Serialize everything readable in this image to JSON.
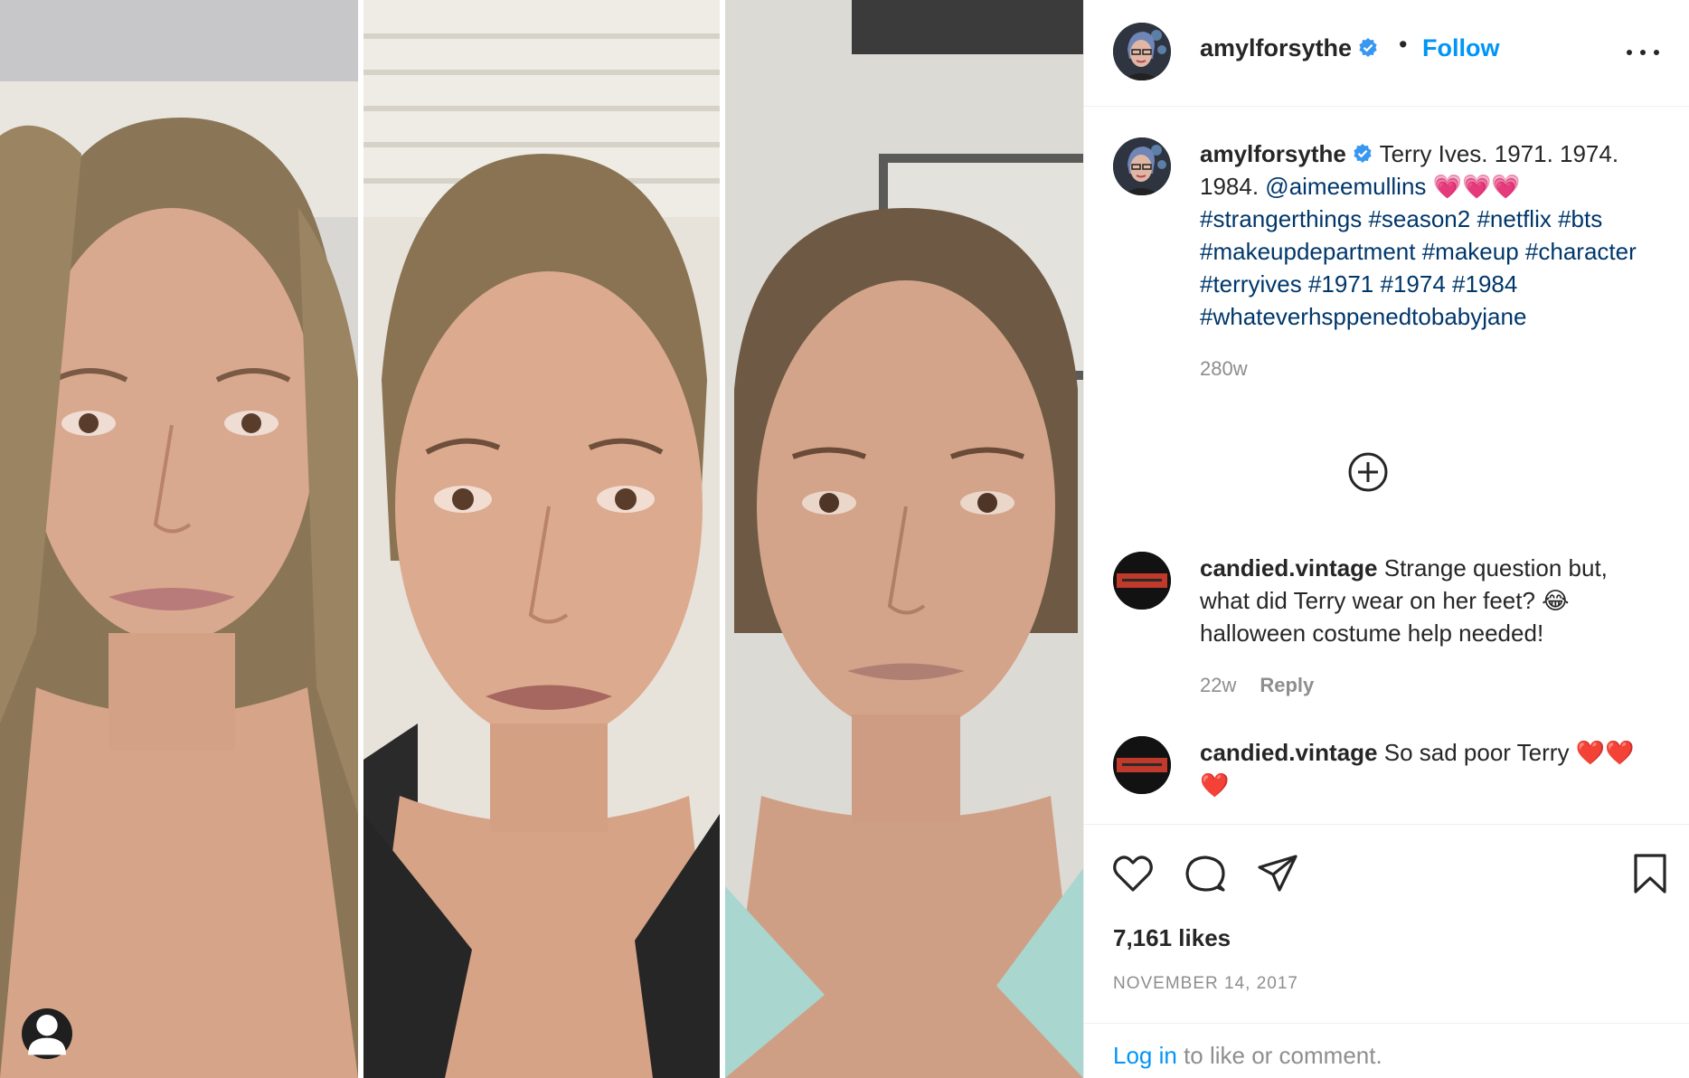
{
  "post": {
    "username": "amylforsythe",
    "follow_label": "Follow",
    "header_dot": "•",
    "caption_parts": [
      {
        "kind": "text",
        "value": " Terry Ives. 1971. 1974. 1984. "
      },
      {
        "kind": "tag",
        "value": "@aimeemullins"
      },
      {
        "kind": "text",
        "value": " 💗💗💗 "
      },
      {
        "kind": "tag",
        "value": "#strangerthings"
      },
      {
        "kind": "text",
        "value": " "
      },
      {
        "kind": "tag",
        "value": "#season2"
      },
      {
        "kind": "text",
        "value": " "
      },
      {
        "kind": "tag",
        "value": "#netflix"
      },
      {
        "kind": "text",
        "value": " "
      },
      {
        "kind": "tag",
        "value": "#bts"
      },
      {
        "kind": "text",
        "value": " "
      },
      {
        "kind": "tag",
        "value": "#makeupdepartment"
      },
      {
        "kind": "text",
        "value": " "
      },
      {
        "kind": "tag",
        "value": "#makeup"
      },
      {
        "kind": "text",
        "value": " "
      },
      {
        "kind": "tag",
        "value": "#character"
      },
      {
        "kind": "text",
        "value": " "
      },
      {
        "kind": "tag",
        "value": "#terryives"
      },
      {
        "kind": "text",
        "value": " "
      },
      {
        "kind": "tag",
        "value": "#1971"
      },
      {
        "kind": "text",
        "value": " "
      },
      {
        "kind": "tag",
        "value": "#1974"
      },
      {
        "kind": "text",
        "value": " "
      },
      {
        "kind": "tag",
        "value": "#1984"
      },
      {
        "kind": "text",
        "value": " "
      },
      {
        "kind": "tag",
        "value": "#whateverhsppenedtobabyjane"
      }
    ],
    "caption_age": "280w",
    "likes": "7,161 likes",
    "date": "NOVEMBER 14, 2017",
    "login_link": "Log in",
    "login_rest": " to like or comment."
  },
  "comments": [
    {
      "username": "candied.vintage",
      "text": " Strange question but, what did Terry wear on her feet? 😂 halloween costume help needed!",
      "age": "22w",
      "reply_label": "Reply"
    },
    {
      "username": "candied.vintage",
      "text": " So sad poor Terry ❤️❤️❤️"
    }
  ],
  "icons": {
    "verified": "verified-badge-icon",
    "more": "more-options-icon",
    "load_more": "plus-circle-icon",
    "like": "heart-icon",
    "comment": "comment-bubble-icon",
    "share": "paper-plane-icon",
    "save": "bookmark-icon",
    "user_tag": "user-tag-icon"
  },
  "colors": {
    "accent": "#0095f6",
    "hashtag": "#00376b",
    "muted": "#8e8e8e",
    "verified": "#3897f0"
  }
}
